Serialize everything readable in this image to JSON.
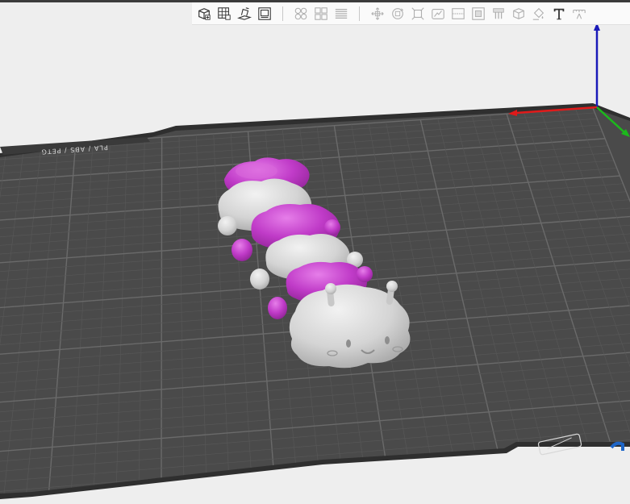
{
  "app": {
    "title": ""
  },
  "toolbar": {
    "groups": [
      [
        "add-object-icon",
        "arrange-grid-icon",
        "auto-orient-icon",
        "plate-settings-icon"
      ],
      [
        "split-objects-icon",
        "split-parts-icon",
        "layers-icon"
      ],
      [
        "move-icon",
        "rotate-icon",
        "scale-icon",
        "place-on-face-icon",
        "cut-icon",
        "mesh-boolean-icon",
        "support-paint-icon",
        "seam-paint-icon",
        "color-paint-icon",
        "text-tool-icon",
        "measure-icon"
      ]
    ]
  },
  "build_plate": {
    "label": "PLA / ABS / PETG",
    "colors": {
      "plate": "#4a4a4a",
      "grid_minor": "#575757",
      "grid_major": "#6a6a6a",
      "rim": "#2e2e2e",
      "background": "#eeeeee"
    }
  },
  "model": {
    "colors": {
      "white_segment": "#d6d6d6",
      "purple_segment": "#c03bc8"
    }
  },
  "axes": {
    "x_color": "#e01a1a",
    "y_color": "#1cb81c",
    "z_color": "#1a1ab8"
  }
}
